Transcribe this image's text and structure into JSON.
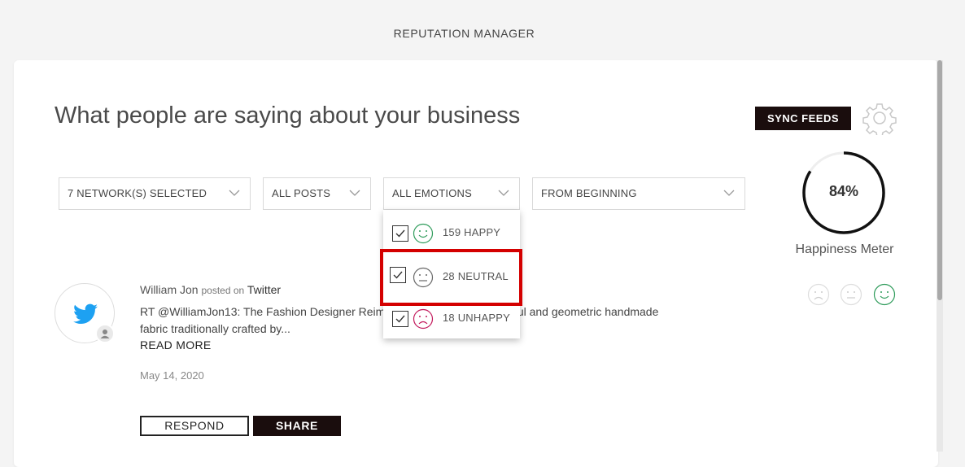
{
  "app_title": "REPUTATION MANAGER",
  "headline": "What people are saying about your business",
  "sync_button": "SYNC FEEDS",
  "icons": {
    "settings": "gear-icon",
    "network": "twitter-icon",
    "user": "user-icon"
  },
  "filters": {
    "networks": "7 NETWORK(S) SELECTED",
    "posts": "ALL POSTS",
    "emotions": "ALL EMOTIONS",
    "timeframe": "FROM BEGINNING"
  },
  "emotion_dropdown": {
    "items": [
      {
        "count": "159",
        "label": "HAPPY",
        "checked": true,
        "color": "#2e9b5a"
      },
      {
        "count": "28",
        "label": "NEUTRAL",
        "checked": true,
        "color": "#666666"
      },
      {
        "count": "18",
        "label": "UNHAPPY",
        "checked": true,
        "color": "#c2185b"
      }
    ]
  },
  "happiness_meter": {
    "value": 0.84,
    "percent_text": "84%",
    "label": "Happiness Meter"
  },
  "post": {
    "author": "William Jon",
    "posted_on": "posted on",
    "network": "Twitter",
    "text_start": "RT @WilliamJon13: The Fashion Designer Reimag",
    "text_end": "a colorful and geometric handmade",
    "text_line2": "fabric traditionally crafted by...",
    "read_more": "READ MORE",
    "date": "May 14, 2020",
    "respond": "RESPOND",
    "share": "SHARE",
    "selected_emotion": "happy"
  },
  "colors": {
    "accent_dark": "#1a0d0d",
    "highlight": "#d40000",
    "happy": "#2e9b5a",
    "unhappy": "#c2185b",
    "twitter": "#1da1f2"
  }
}
